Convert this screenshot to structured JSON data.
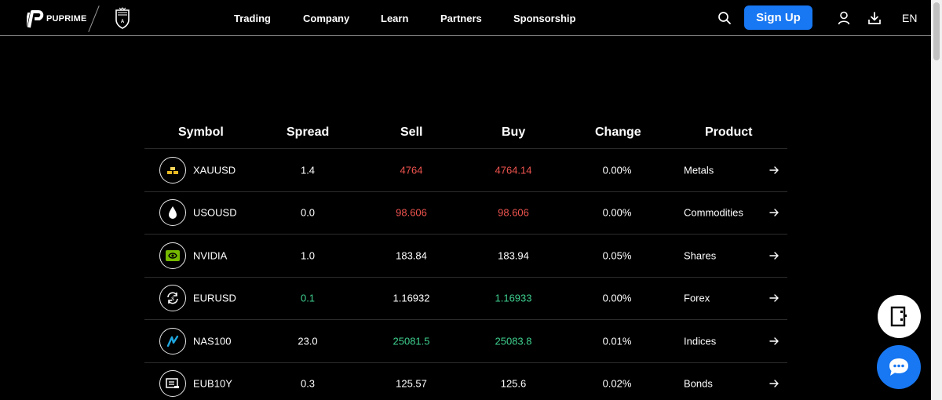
{
  "header": {
    "logo_text": "PUPRIME",
    "nav": [
      "Trading",
      "Company",
      "Learn",
      "Partners",
      "Sponsorship"
    ],
    "signup_label": "Sign Up",
    "language": "EN",
    "icons": [
      "search-icon",
      "user-icon",
      "download-icon"
    ]
  },
  "table": {
    "columns": [
      "Symbol",
      "Spread",
      "Sell",
      "Buy",
      "Change",
      "Product"
    ],
    "rows": [
      {
        "icon": "gold-bars-icon",
        "symbol": "XAUUSD",
        "spread": "1.4",
        "sell": "4764",
        "buy": "4764.14",
        "change": "0.00%",
        "product": "Metals",
        "spread_color": "white",
        "sell_color": "red",
        "buy_color": "red"
      },
      {
        "icon": "oil-drop-icon",
        "symbol": "USOUSD",
        "spread": "0.0",
        "sell": "98.606",
        "buy": "98.606",
        "change": "0.00%",
        "product": "Commodities",
        "spread_color": "white",
        "sell_color": "red",
        "buy_color": "red"
      },
      {
        "icon": "nvidia-icon",
        "symbol": "NVIDIA",
        "spread": "1.0",
        "sell": "183.84",
        "buy": "183.94",
        "change": "0.05%",
        "product": "Shares",
        "spread_color": "white",
        "sell_color": "white",
        "buy_color": "white"
      },
      {
        "icon": "currency-exchange-icon",
        "symbol": "EURUSD",
        "spread": "0.1",
        "sell": "1.16932",
        "buy": "1.16933",
        "change": "0.00%",
        "product": "Forex",
        "spread_color": "green",
        "sell_color": "white",
        "buy_color": "green"
      },
      {
        "icon": "nasdaq-icon",
        "symbol": "NAS100",
        "spread": "23.0",
        "sell": "25081.5",
        "buy": "25083.8",
        "change": "0.01%",
        "product": "Indices",
        "spread_color": "white",
        "sell_color": "green",
        "buy_color": "green"
      },
      {
        "icon": "bond-certificate-icon",
        "symbol": "EUB10Y",
        "spread": "0.3",
        "sell": "125.57",
        "buy": "125.6",
        "change": "0.02%",
        "product": "Bonds",
        "spread_color": "white",
        "sell_color": "white",
        "buy_color": "white"
      }
    ]
  },
  "floating": {
    "doc_icon": "document-icon",
    "chat_icon": "chat-icon"
  },
  "colors": {
    "accent": "#1877f2",
    "up": "#3ecf8e",
    "down": "#f0544f",
    "gold": "#e8b923",
    "nvidia": "#76b900",
    "nasdaq": "#1fa7e0"
  }
}
